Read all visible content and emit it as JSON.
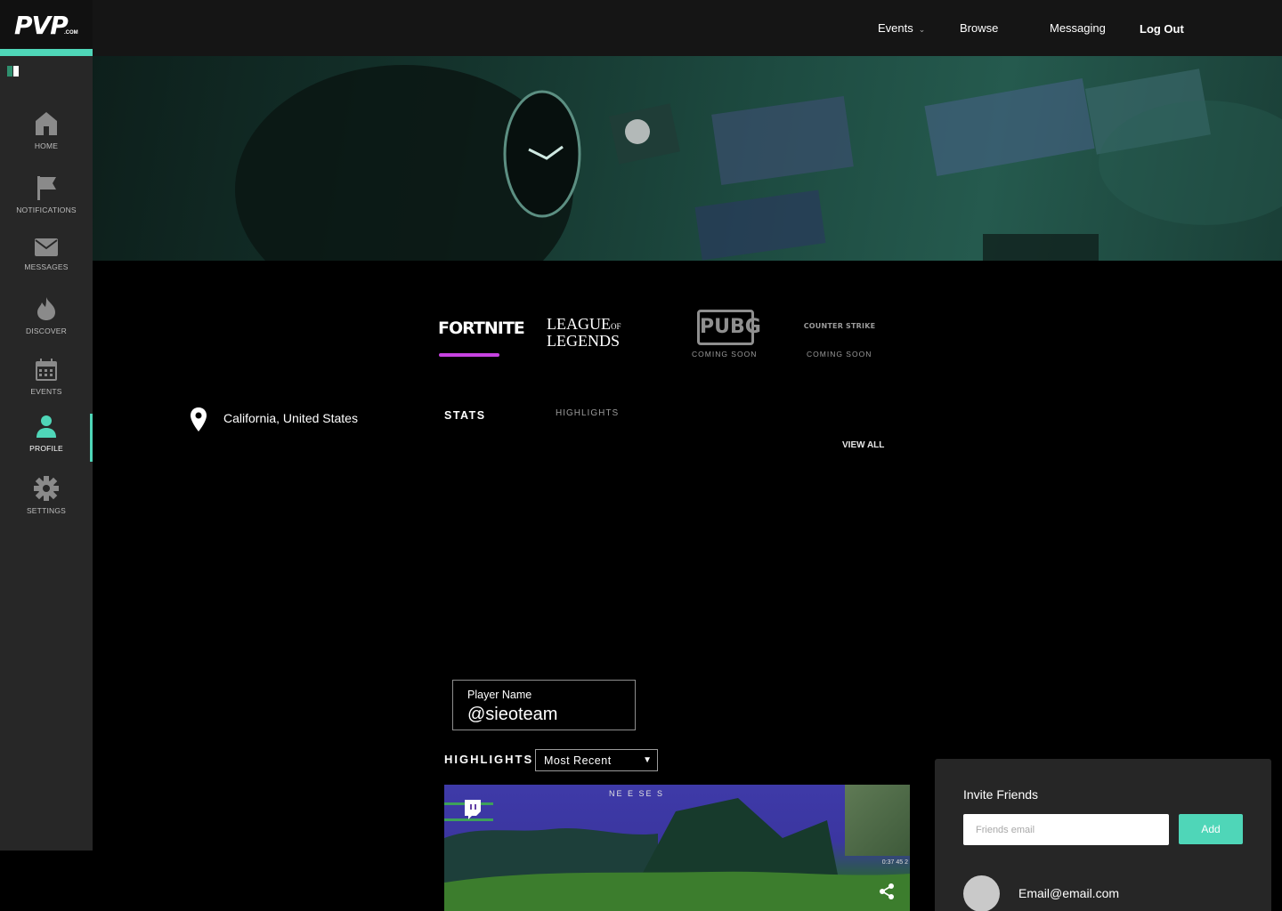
{
  "brand": {
    "logo_main_p1": "PV",
    "logo_main_v": "P",
    "logo_sub": ".COM"
  },
  "topnav": {
    "events": "Events",
    "browse": "Browse",
    "messaging": "Messaging",
    "logout": "Log Out"
  },
  "sidebar": {
    "items": [
      {
        "label": "HOME",
        "icon": "home-icon"
      },
      {
        "label": "NOTIFICATIONS",
        "icon": "flag-icon"
      },
      {
        "label": "MESSAGES",
        "icon": "envelope-icon"
      },
      {
        "label": "DISCOVER",
        "icon": "flame-icon"
      },
      {
        "label": "EVENTS",
        "icon": "calendar-icon"
      },
      {
        "label": "PROFILE",
        "icon": "person-icon",
        "active": true
      },
      {
        "label": "SETTINGS",
        "icon": "gear-icon"
      }
    ]
  },
  "games": {
    "fortnite": "FORTNITE",
    "lol_line1": "LEAGUE",
    "lol_of": "OF",
    "lol_line2": "LEGENDS",
    "pubg": "PUBG",
    "cs": "COUNTER STRIKE",
    "coming_soon_1": "COMING SOON",
    "coming_soon_2": "COMING SOON"
  },
  "profile": {
    "location": "California, United States",
    "tab_stats": "STATS",
    "tab_highlights": "HIGHLIGHTS",
    "view_all": "VIEW ALL",
    "player_name_label": "Player Name",
    "player_name_value": "@sieoteam",
    "highlights_label": "HIGHLIGHTS",
    "highlights_sort": "Most Recent"
  },
  "video": {
    "compass": "NE   E   SE   S",
    "hud": "0:37  45  2"
  },
  "invite": {
    "title": "Invite Friends",
    "email_placeholder": "Friends email",
    "add_label": "Add",
    "friend_email": "Email@email.com"
  },
  "colors": {
    "accent": "#4fd6b8",
    "fortnite_underline": "#c743e0",
    "sidebar_bg": "#272727",
    "topbar_bg": "#151515"
  }
}
